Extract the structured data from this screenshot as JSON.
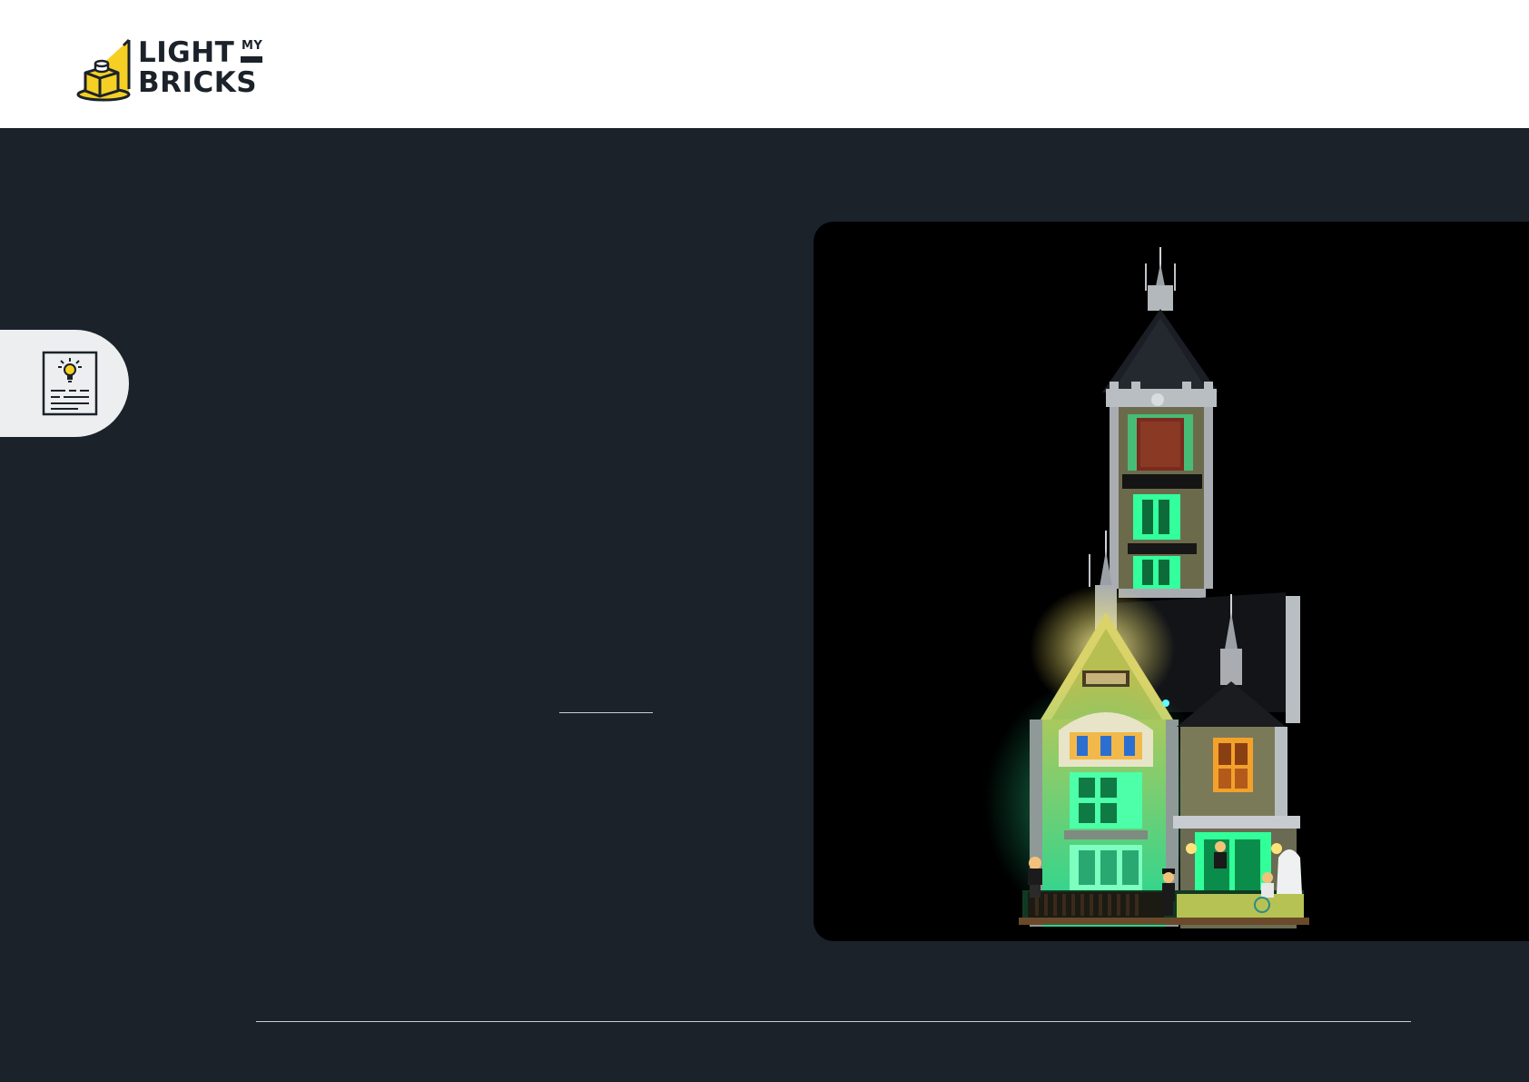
{
  "header": {
    "logo": {
      "word_top": "LIGHT",
      "word_small": "MY",
      "word_bottom": "BRICKS",
      "icon": "lit-brick-logo-icon",
      "brand_yellow": "#f6cf24",
      "brand_dark": "#1b222a"
    }
  },
  "side_tab": {
    "icon": "instruction-document-lightbulb-icon"
  },
  "product_image": {
    "subject": "lit-haunted-house-model-image"
  },
  "colors": {
    "page_background": "#1b222a",
    "header_background": "#ffffff",
    "side_tab_background": "#eceeef",
    "photo_background": "#000000",
    "rule_color": "#c9ced3"
  }
}
